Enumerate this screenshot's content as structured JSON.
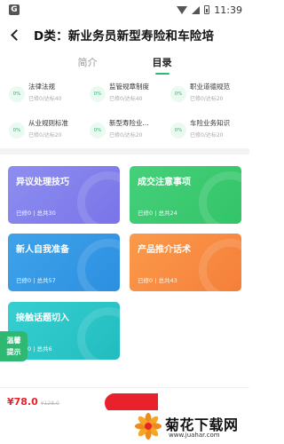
{
  "status_bar": {
    "notification_icon": "G",
    "time": "11:39"
  },
  "header": {
    "title": "D类：新业务员新型寿险和车险培"
  },
  "tabs": [
    {
      "label": "简介",
      "active": false
    },
    {
      "label": "目录",
      "active": true
    }
  ],
  "topics": [
    {
      "percent": "0%",
      "name": "法律法规",
      "progress": "已修0/达标40"
    },
    {
      "percent": "0%",
      "name": "监管规章制度",
      "progress": "已修0/达标40"
    },
    {
      "percent": "0%",
      "name": "职业道德规范",
      "progress": "已修0/达标20"
    },
    {
      "percent": "0%",
      "name": "从业规则标准",
      "progress": "已修0/达标20"
    },
    {
      "percent": "0%",
      "name": "新型寿险业...",
      "progress": "已修0/达标20"
    },
    {
      "percent": "0%",
      "name": "车险业务知识",
      "progress": "已修0/达标20"
    }
  ],
  "courses": [
    {
      "title": "异议处理技巧",
      "meta": "已修0 | 总共30",
      "color_from": "#8d8ef0",
      "color_to": "#7a74e8"
    },
    {
      "title": "成交注意事项",
      "meta": "已修0 | 总共24",
      "color_from": "#45d07a",
      "color_to": "#34c468"
    },
    {
      "title": "新人自我准备",
      "meta": "已修0 | 总共57",
      "color_from": "#3fa3ea",
      "color_to": "#2d8fe0"
    },
    {
      "title": "产品推介话术",
      "meta": "已修0 | 总共43",
      "color_from": "#fb9a4a",
      "color_to": "#f57f3a"
    },
    {
      "title": "接触话题切入",
      "meta": "已修0 | 总共6",
      "color_from": "#37cfd0",
      "color_to": "#22bcc0"
    }
  ],
  "reminder": {
    "line1": "温馨",
    "line2": "提示"
  },
  "purchase": {
    "price": "¥78.0",
    "original_price": "¥128.0"
  },
  "watermark": {
    "name": "菊花下载网",
    "url": "www.juahar.com"
  },
  "colors": {
    "accent": "#2fb872",
    "price_red": "#e8212c"
  }
}
